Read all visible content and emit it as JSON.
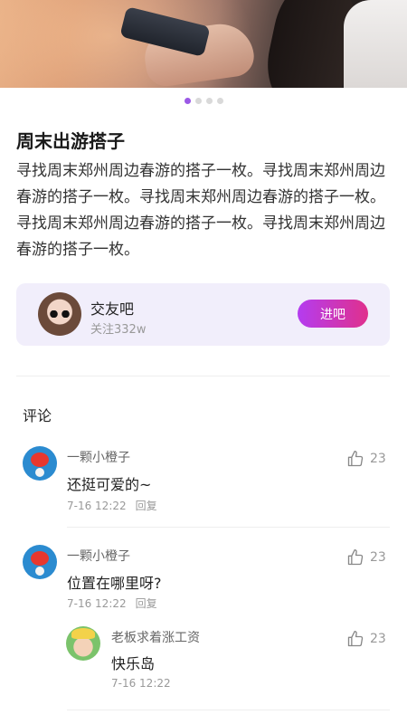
{
  "carousel": {
    "total": 4,
    "active": 0
  },
  "post": {
    "title": "周末出游搭子",
    "body": "寻找周末郑州周边春游的搭子一枚。寻找周末郑州周边春游的搭子一枚。寻找周末郑州周边春游的搭子一枚。寻找周末郑州周边春游的搭子一枚。寻找周末郑州周边春游的搭子一枚。"
  },
  "group": {
    "name": "交友吧",
    "followers": "关注332w",
    "enter_label": "进吧"
  },
  "comments_section": {
    "title": "评论",
    "items": [
      {
        "user": "一颗小橙子",
        "text": "还挺可爱的~",
        "time": "7-16 12:22",
        "reply_label": "回复",
        "likes": "23"
      },
      {
        "user": "一颗小橙子",
        "text": "位置在哪里呀?",
        "time": "7-16 12:22",
        "reply_label": "回复",
        "likes": "23"
      },
      {
        "user": "老板求着涨工资",
        "text": "快乐岛",
        "time": "7-16 12:22",
        "likes": "23"
      }
    ]
  },
  "colors": {
    "accent": "#9b59e6",
    "button_from": "#b43cf0",
    "button_to": "#e0308c",
    "card_bg": "#f1eefb"
  },
  "icons": {
    "like": "thumbs-up-icon"
  }
}
